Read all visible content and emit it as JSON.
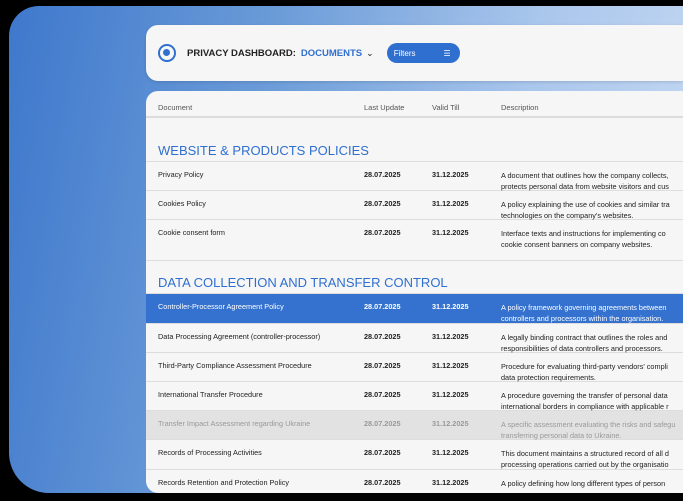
{
  "header": {
    "title": "PRIVACY DASHBOARD:",
    "crumb": "DOCUMENTS",
    "filters_label": "Filters"
  },
  "columns": [
    "Document",
    "Last Update",
    "Valid Till",
    "Description"
  ],
  "sections": [
    {
      "title": "WEBSITE & PRODUCTS POLICIES",
      "rows": [
        {
          "name": "Privacy Policy",
          "updated": "28.07.2025",
          "valid": "31.12.2025",
          "desc1": "A document that outlines how the company collects,",
          "desc2": "protects personal data from website visitors and cus"
        },
        {
          "name": "Cookies Policy",
          "updated": "28.07.2025",
          "valid": "31.12.2025",
          "desc1": "A policy explaining the use of cookies and similar tra",
          "desc2": "technologies on the company's websites."
        },
        {
          "name": "Cookie consent form",
          "updated": "28.07.2025",
          "valid": "31.12.2025",
          "desc1": "Interface texts and instructions for implementing co",
          "desc2": "cookie consent banners on company websites."
        }
      ]
    },
    {
      "title": "DATA COLLECTION AND TRANSFER CONTROL",
      "rows": [
        {
          "name": "Controller-Processor Agreement Policy",
          "updated": "28.07.2025",
          "valid": "31.12.2025",
          "desc1": "A policy framework governing agreements between",
          "desc2": "controllers and processors within the organisation."
        },
        {
          "name": "Data Processing Agreement (controller-processor)",
          "updated": "28.07.2025",
          "valid": "31.12.2025",
          "desc1": "A legally binding contract that outlines the roles and",
          "desc2": "responsibilities of data controllers and processors."
        },
        {
          "name": "Third-Party Compliance Assessment Procedure",
          "updated": "28.07.2025",
          "valid": "31.12.2025",
          "desc1": "Procedure for evaluating third-party vendors' compli",
          "desc2": "data protection requirements."
        },
        {
          "name": "International Transfer Procedure",
          "updated": "28.07.2025",
          "valid": "31.12.2025",
          "desc1": "A procedure governing the transfer of personal data",
          "desc2": "international borders in compliance with applicable r"
        },
        {
          "name": "Transfer Impact Assessment regarding Ukraine",
          "updated": "28.07.2025",
          "valid": "31.12.2025",
          "desc1": "A specific assessment evaluating the risks and safegu",
          "desc2": "transferring personal data to Ukraine."
        },
        {
          "name": "Records of Processing Activities",
          "updated": "28.07.2025",
          "valid": "31.12.2025",
          "desc1": "This document maintains a structured record of all d",
          "desc2": "processing operations carried out by the organisatio"
        },
        {
          "name": "Records Retention and Protection Policy",
          "updated": "28.07.2025",
          "valid": "31.12.2025",
          "desc1": "A policy defining how long different types of person",
          "desc2": ""
        }
      ]
    }
  ]
}
